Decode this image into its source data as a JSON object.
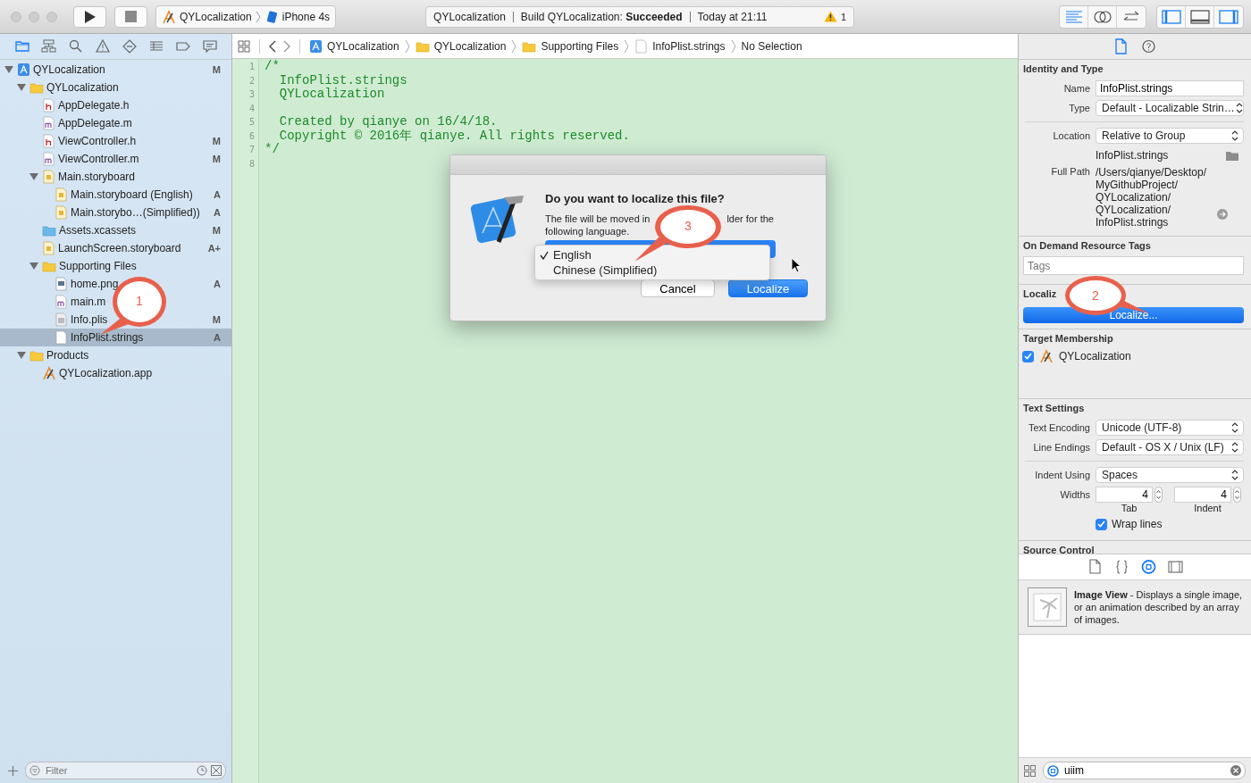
{
  "toolbar": {
    "scheme": {
      "project": "QYLocalization",
      "device": "iPhone 4s"
    },
    "activity": {
      "project": "QYLocalization",
      "status": "Build QYLocalization: **Succeeded**",
      "time": "Today at 21:11",
      "warnings": "1"
    },
    "editor_modes": [
      {
        "kind": "standard",
        "selected": true
      },
      {
        "kind": "assistant",
        "selected": false
      },
      {
        "kind": "version",
        "selected": false
      }
    ],
    "views": [
      {
        "kind": "navigator",
        "selected": true
      },
      {
        "kind": "debug",
        "selected": false
      },
      {
        "kind": "utilities",
        "selected": true
      }
    ]
  },
  "navigator": {
    "tabs": [
      {
        "kind": "folder",
        "selected": true
      },
      {
        "kind": "hierarchy",
        "selected": false
      },
      {
        "kind": "search",
        "selected": false
      },
      {
        "kind": "warning",
        "selected": false
      },
      {
        "kind": "test",
        "selected": false
      },
      {
        "kind": "debug",
        "selected": false
      },
      {
        "kind": "breakpoint",
        "selected": false
      },
      {
        "kind": "report",
        "selected": false
      }
    ],
    "tree": [
      {
        "name": "QYLocalization",
        "kind": "project",
        "status": "M",
        "expanded": true,
        "selected": false,
        "children": [
          {
            "name": "QYLocalization",
            "kind": "folder",
            "expanded": true,
            "selected": false,
            "children": [
              {
                "name": "AppDelegate.h",
                "kind": "h",
                "selected": false
              },
              {
                "name": "AppDelegate.m",
                "kind": "m",
                "selected": false
              },
              {
                "name": "ViewController.h",
                "kind": "h",
                "status": "M",
                "selected": false
              },
              {
                "name": "ViewController.m",
                "kind": "m",
                "status": "M",
                "selected": false
              },
              {
                "name": "Main.storyboard",
                "kind": "storyboard",
                "expanded": true,
                "selected": false,
                "children": [
                  {
                    "name": "Main.storyboard (English)",
                    "kind": "storyboard",
                    "status": "A",
                    "selected": false
                  },
                  {
                    "name": "Main.storybo…(Simplified))",
                    "kind": "storyboard",
                    "status": "A",
                    "selected": false
                  }
                ]
              },
              {
                "name": "Assets.xcassets",
                "kind": "xcassets",
                "status": "M",
                "selected": false
              },
              {
                "name": "LaunchScreen.storyboard",
                "kind": "storyboard",
                "status": "A+",
                "selected": false
              },
              {
                "name": "Supporting Files",
                "kind": "folder",
                "expanded": true,
                "selected": false,
                "children": [
                  {
                    "name": "home.png",
                    "kind": "png",
                    "status": "A",
                    "selected": false
                  },
                  {
                    "name": "main.m",
                    "kind": "m",
                    "selected": false
                  },
                  {
                    "name": "Info.plis",
                    "kind": "plist",
                    "status": "M",
                    "selected": false
                  },
                  {
                    "name": "InfoPlist.strings",
                    "kind": "strings",
                    "status": "A",
                    "selected": true
                  }
                ]
              }
            ]
          },
          {
            "name": "Products",
            "kind": "folder",
            "expanded": true,
            "selected": false,
            "children": [
              {
                "name": "QYLocalization.app",
                "kind": "app",
                "selected": false
              }
            ]
          }
        ]
      }
    ],
    "filter": {
      "placeholder": "Filter"
    }
  },
  "editor": {
    "jump_bar": [
      {
        "label": "QYLocalization",
        "kind": "project"
      },
      {
        "label": "QYLocalization",
        "kind": "folder"
      },
      {
        "label": "Supporting Files",
        "kind": "folder"
      },
      {
        "label": "InfoPlist.strings",
        "kind": "file"
      },
      {
        "label": "No Selection",
        "kind": "none"
      }
    ],
    "lines": [
      {
        "number": "1",
        "text": "/*"
      },
      {
        "number": "2",
        "text": "  InfoPlist.strings"
      },
      {
        "number": "3",
        "text": "  QYLocalization"
      },
      {
        "number": "4"
      },
      {
        "number": "5",
        "text": "  Created by qianye on 16/4/18."
      },
      {
        "number": "6",
        "text": "  Copyright © 2016年 qianye. All rights reserved."
      },
      {
        "number": "7",
        "text": "*/"
      },
      {
        "number": "8"
      }
    ]
  },
  "dialog": {
    "title": "Do you want to localize this file?",
    "message_start": "The file will be moved in",
    "message_end": "lder for the",
    "message_line2": "following language.",
    "languages": [
      {
        "label": "English",
        "selected": true
      },
      {
        "label": "Chinese (Simplified)",
        "selected": false
      }
    ],
    "buttons": [
      {
        "label": "Cancel",
        "kind": "secondary"
      },
      {
        "label": "Localize",
        "kind": "primary"
      }
    ]
  },
  "inspector": {
    "tabs": [
      {
        "kind": "file",
        "selected": true
      },
      {
        "kind": "help",
        "selected": false
      }
    ],
    "identity": {
      "title": "Identity and Type",
      "rows": [
        {
          "label": "Name",
          "value": "InfoPlist.strings",
          "kind": "field"
        },
        {
          "label": "Type",
          "value": "Default - Localizable Strin…",
          "kind": "popup"
        },
        {
          "label": "Location",
          "value": "Relative to Group",
          "kind": "popup"
        }
      ],
      "file": "InfoPlist.strings",
      "full_path_label": "Full Path",
      "full_path": [
        "/Users/qianye/Desktop/",
        "MyGithubProject/",
        "QYLocalization/",
        "QYLocalization/",
        "InfoPlist.strings"
      ]
    },
    "tags": {
      "title": "On Demand Resource Tags",
      "placeholder": "Tags"
    },
    "localization": {
      "title": "Localiz",
      "button": "Localize..."
    },
    "target": {
      "title": "Target Membership",
      "items": [
        {
          "name": "QYLocalization",
          "checked": true
        }
      ]
    },
    "text_settings": {
      "title": "Text Settings",
      "rows": [
        {
          "label": "Text Encoding",
          "value": "Unicode (UTF-8)"
        },
        {
          "label": "Line Endings",
          "value": "Default - OS X / Unix (LF)"
        },
        {
          "label": "Indent Using",
          "value": "Spaces"
        }
      ],
      "widths_label": "Widths",
      "widths": [
        {
          "value": "4",
          "caption": "Tab"
        },
        {
          "value": "4",
          "caption": "Indent"
        }
      ],
      "wrap": {
        "label": "Wrap lines",
        "checked": true
      }
    },
    "source_control": {
      "title": "Source Control"
    },
    "library": {
      "tabs": [
        {
          "kind": "file",
          "selected": false
        },
        {
          "kind": "code",
          "selected": false
        },
        {
          "kind": "object",
          "selected": true
        },
        {
          "kind": "media",
          "selected": false
        }
      ],
      "items": [
        {
          "description": "**Image View** - Displays a single image, or an animation described by an array of images."
        }
      ],
      "filter": {
        "value": "uiim"
      }
    }
  },
  "callouts": [
    {
      "number": "1",
      "kind": "nav"
    },
    {
      "number": "2",
      "kind": "inspector"
    },
    {
      "number": "3",
      "kind": "dialog"
    }
  ]
}
